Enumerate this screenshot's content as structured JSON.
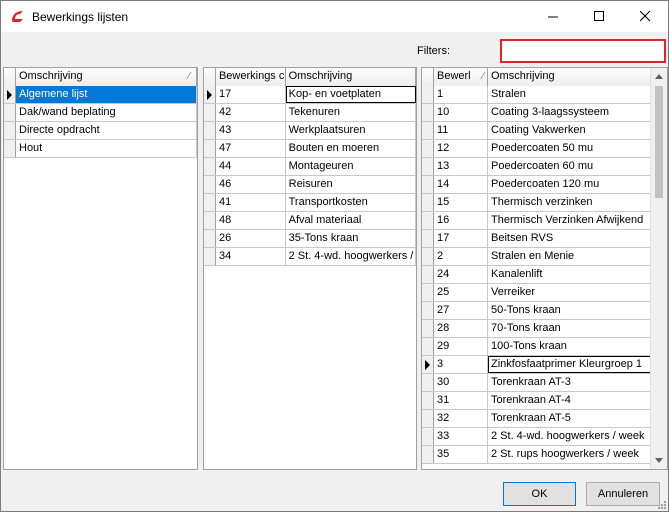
{
  "window": {
    "title": "Bewerkings lijsten"
  },
  "filters": {
    "label": "Filters:",
    "value": "",
    "border_color": "#e0252a"
  },
  "list1": {
    "columns": [
      "Omschrijving"
    ],
    "rows": [
      "Algemene lijst",
      "Dak/wand beplating",
      "Directe opdracht",
      "Hout"
    ]
  },
  "list2": {
    "columns": [
      "Bewerkings co",
      "Omschrijving"
    ],
    "rows": [
      [
        "17",
        "Kop- en voetplaten"
      ],
      [
        "42",
        "Tekenuren"
      ],
      [
        "43",
        "Werkplaatsuren"
      ],
      [
        "47",
        "Bouten en moeren"
      ],
      [
        "44",
        "Montageuren"
      ],
      [
        "46",
        "Reisuren"
      ],
      [
        "41",
        "Transportkosten"
      ],
      [
        "48",
        "Afval materiaal"
      ],
      [
        "26",
        "35-Tons kraan"
      ],
      [
        "34",
        "2 St. 4-wd. hoogwerkers / "
      ]
    ]
  },
  "list3": {
    "columns": [
      "Bewerl",
      "Omschrijving"
    ],
    "rows": [
      [
        "1",
        "Stralen"
      ],
      [
        "10",
        "Coating 3-laagssysteem"
      ],
      [
        "11",
        "Coating Vakwerken"
      ],
      [
        "12",
        "Poedercoaten 50 mu"
      ],
      [
        "13",
        "Poedercoaten 60 mu"
      ],
      [
        "14",
        "Poedercoaten 120 mu"
      ],
      [
        "15",
        "Thermisch verzinken"
      ],
      [
        "16",
        "Thermisch Verzinken Afwijkend"
      ],
      [
        "17",
        "Beitsen RVS"
      ],
      [
        "2",
        "Stralen en Menie"
      ],
      [
        "24",
        "Kanalenlift"
      ],
      [
        "25",
        "Verreiker"
      ],
      [
        "27",
        "50-Tons kraan"
      ],
      [
        "28",
        "70-Tons kraan"
      ],
      [
        "29",
        "100-Tons kraan"
      ],
      [
        "3",
        "Zinkfosfaatprimer Kleurgroep 1"
      ],
      [
        "30",
        "Torenkraan AT-3"
      ],
      [
        "31",
        "Torenkraan AT-4"
      ],
      [
        "32",
        "Torenkraan AT-5"
      ],
      [
        "33",
        "2 St. 4-wd. hoogwerkers / week"
      ],
      [
        "35",
        "2 St. rups hoogwerkers / week"
      ]
    ]
  },
  "buttons": {
    "ok": "OK",
    "cancel": "Annuleren"
  },
  "colors": {
    "selection": "#0078d7",
    "brand": "#e0252a"
  }
}
